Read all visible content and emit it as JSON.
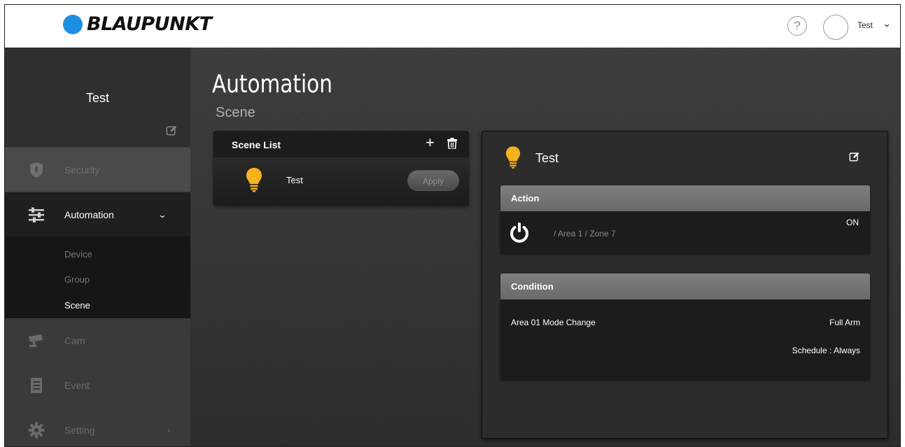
{
  "header": {
    "brand": "BLAUPUNKT",
    "help_label": "?",
    "user_name": "Test",
    "user_caret": "⌄"
  },
  "sidebar": {
    "profile_name": "Test",
    "items": [
      {
        "label": "Security",
        "icon": "shield-icon"
      },
      {
        "label": "Automation",
        "icon": "sliders-icon",
        "expanded": true
      },
      {
        "label": "Cam",
        "icon": "camera-icon"
      },
      {
        "label": "Event",
        "icon": "list-icon"
      },
      {
        "label": "Setting",
        "icon": "gear-icon"
      }
    ],
    "automation_caret": "⌄",
    "setting_caret": "›",
    "submenu": {
      "device": "Device",
      "group": "Group",
      "scene": "Scene"
    }
  },
  "main": {
    "title": "Automation",
    "subtitle": "Scene"
  },
  "scene_list": {
    "title": "Scene List",
    "add_label": "+",
    "rows": [
      {
        "name": "Test",
        "apply_label": "Apply"
      }
    ]
  },
  "detail": {
    "name": "Test",
    "action": {
      "title": "Action",
      "target": "/ Area 1 / Zone 7",
      "value": "ON"
    },
    "condition": {
      "title": "Condition",
      "label": "Area 01 Mode Change",
      "value": "Full Arm",
      "schedule": "Schedule : Always"
    }
  },
  "colors": {
    "brand_blue": "#1e8fe0",
    "bulb_yellow": "#f6b21b",
    "sidebar_active": "#1f1f1f"
  }
}
